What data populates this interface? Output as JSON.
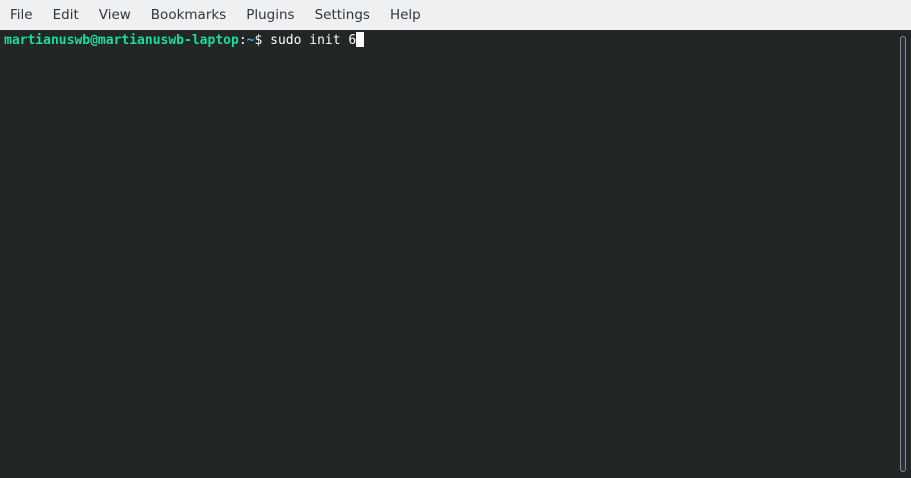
{
  "menu": {
    "items": [
      "File",
      "Edit",
      "View",
      "Bookmarks",
      "Plugins",
      "Settings",
      "Help"
    ]
  },
  "terminal": {
    "prompt_user_host": "martianuswb@martianuswb-laptop",
    "prompt_sep": ":",
    "prompt_path": "~",
    "prompt_symbol": "$ ",
    "command": "sudo init 6"
  },
  "colors": {
    "background": "#232627",
    "user_host": "#1cdc9a",
    "path": "#3daee9",
    "text": "#fcfcfc",
    "menubar": "#eff0f1"
  }
}
